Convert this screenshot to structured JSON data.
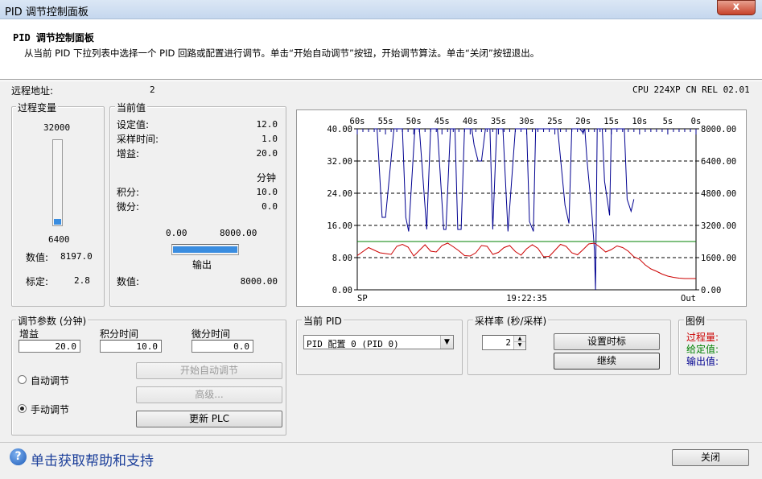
{
  "window": {
    "title": "PID 调节控制面板",
    "close_glyph": "x"
  },
  "header": {
    "title": "PID 调节控制面板",
    "instructions": "从当前 PID 下拉列表中选择一个 PID 回路或配置进行调节。单击“开始自动调节”按钮，开始调节算法。单击“关闭”按钮退出。"
  },
  "remote": {
    "label": "远程地址:",
    "value": "2",
    "cpu": "CPU 224XP CN REL 02.01"
  },
  "process_var": {
    "group_label": "过程变量",
    "max_label": "32000",
    "min_label": "6400",
    "bar_level_fraction": 0.067,
    "value_label": "数值:",
    "value": "8197.0",
    "scaled_label": "标定:",
    "scaled": "2.8"
  },
  "current": {
    "group_label": "当前值",
    "setpoint_label": "设定值:",
    "setpoint": "12.0",
    "sample_label": "采样时间:",
    "sample": "1.0",
    "gain_label": "增益:",
    "gain": "20.0",
    "minutes_label": "分钟",
    "integral_label": "积分:",
    "integral": "10.0",
    "derivative_label": "微分:",
    "derivative": "0.0",
    "out_min": "0.00",
    "out_max": "8000.00",
    "output_label": "输出",
    "output_fraction": 1.0,
    "value_label": "数值:",
    "value": "8000.00"
  },
  "chart_data": {
    "type": "line",
    "time_ticks": [
      "60s",
      "55s",
      "50s",
      "45s",
      "40s",
      "35s",
      "30s",
      "25s",
      "20s",
      "15s",
      "10s",
      "5s",
      "0s"
    ],
    "x_time": [
      60,
      58,
      57,
      56,
      55,
      54,
      53,
      52,
      51,
      50,
      49,
      48,
      47,
      46,
      45,
      44,
      43,
      42,
      41,
      40,
      39,
      38,
      37,
      36,
      35,
      34,
      33,
      32,
      31,
      30,
      29,
      28,
      27,
      26,
      25,
      24,
      23,
      22,
      21,
      20,
      19,
      18,
      17,
      16,
      15,
      14,
      13,
      12,
      11,
      10,
      9,
      8,
      7,
      6,
      5,
      4,
      3,
      2,
      1,
      0
    ],
    "left_axis": {
      "ticks": [
        "40.00",
        "32.00",
        "24.00",
        "16.00",
        "8.00",
        "0.00"
      ],
      "ylim": [
        0,
        40
      ]
    },
    "right_axis": {
      "ticks": [
        "8000.00",
        "6400.00",
        "4800.00",
        "3200.00",
        "1600.00",
        "0.00"
      ],
      "ylim": [
        0,
        8000
      ]
    },
    "bottom_labels": {
      "left": "SP",
      "center": "19:22:35",
      "right": "Out"
    },
    "setpoint_value": 12.0,
    "series": [
      {
        "name": "输出值",
        "color": "#000090",
        "axis": "right",
        "x": [
          57,
          56.5,
          55.6,
          55,
          53.5,
          52,
          51.4,
          50.9,
          49.8,
          49,
          47.7,
          47,
          46.4,
          45.8,
          44.7,
          44.3,
          43.5,
          42.7,
          42.2,
          41.6,
          41,
          40.5,
          40,
          39.7,
          39.3,
          38.6,
          38,
          37.3,
          37,
          36.5,
          36,
          35.3,
          34.5,
          34.2,
          33.3,
          32,
          31.7,
          30.5,
          30,
          29.5,
          28.8,
          28.4,
          27.6,
          27,
          26.4,
          25.7,
          25.3,
          24.5,
          23.2,
          22.5,
          22,
          21.5,
          21,
          20.6,
          20,
          19.7,
          19.3,
          18.5,
          18,
          17.8,
          17.5,
          16.6,
          16.2,
          15.3,
          15,
          14.6,
          13.8,
          13,
          12.7,
          12.2,
          11.5,
          11
        ],
        "y": [
          8000,
          8000,
          3600,
          3600,
          8000,
          8000,
          3600,
          2900,
          8000,
          8000,
          3000,
          8000,
          8000,
          8000,
          3000,
          3000,
          8000,
          8000,
          3000,
          3000,
          8000,
          8000,
          8000,
          8000,
          7200,
          6400,
          6400,
          8000,
          8000,
          8000,
          3000,
          8000,
          8000,
          8000,
          2900,
          8000,
          8000,
          8000,
          8000,
          3400,
          2900,
          8000,
          8000,
          8000,
          8000,
          8000,
          8000,
          8000,
          4200,
          3300,
          8000,
          8000,
          8000,
          8000,
          7800,
          8000,
          6400,
          4000,
          2000,
          0,
          8000,
          8000,
          5400,
          3700,
          8000,
          8000,
          8000,
          8000,
          8000,
          4500,
          3900,
          4500
        ]
      },
      {
        "name": "过程量",
        "color": "#cc0000",
        "axis": "left",
        "x": [
          60,
          58,
          56,
          54,
          53,
          52,
          51,
          50,
          49,
          48,
          47,
          46,
          45,
          44,
          43,
          42,
          41,
          40,
          39,
          38,
          37,
          36,
          35,
          34,
          33,
          32,
          31,
          30,
          29,
          28,
          27,
          26,
          25,
          24,
          23,
          22,
          21,
          20,
          19,
          18,
          17,
          16,
          15,
          14,
          13,
          12,
          11,
          10,
          9,
          8,
          7,
          6,
          5,
          4,
          3,
          2,
          1,
          0
        ],
        "y": [
          8.5,
          10.5,
          9.2,
          8.8,
          10.8,
          11.3,
          10.6,
          8.4,
          9.8,
          11.2,
          9.6,
          9.4,
          11.0,
          11.6,
          10.7,
          9.7,
          8.5,
          8.4,
          9.2,
          11.0,
          10.8,
          8.8,
          9.3,
          10.5,
          11.0,
          9.5,
          8.6,
          10.2,
          11.2,
          10.3,
          8.2,
          8.3,
          9.8,
          11.3,
          10.8,
          9.2,
          8.7,
          10.0,
          11.4,
          11.6,
          10.6,
          9.4,
          10.0,
          10.9,
          10.5,
          9.6,
          8.2,
          7.6,
          6.2,
          5.2,
          4.6,
          3.9,
          3.4,
          3.1,
          2.9,
          2.8,
          2.8,
          2.8
        ]
      },
      {
        "name": "给定值",
        "color": "#008000",
        "axis": "left",
        "x": [
          60,
          0
        ],
        "y": [
          12,
          12
        ]
      }
    ]
  },
  "tuning": {
    "group_label": "调节参数 (分钟)",
    "gain_label": "增益",
    "gain": "20.0",
    "integral_label": "积分时间",
    "integral": "10.0",
    "derivative_label": "微分时间",
    "derivative": "0.0",
    "auto_label": "自动调节",
    "manual_label": "手动调节",
    "start_auto_btn": "开始自动调节",
    "advanced_btn": "高级...",
    "update_plc_btn": "更新 PLC"
  },
  "pid_select": {
    "group_label": "当前 PID",
    "value": "PID 配置 0 (PID 0)"
  },
  "sample_rate": {
    "group_label": "采样率 (秒/采样)",
    "value": "2",
    "set_time_btn": "设置时标",
    "continue_btn": "继续"
  },
  "legend": {
    "group_label": "图例",
    "pv": "过程量:",
    "pv_color": "#cc0000",
    "sp": "给定值:",
    "sp_color": "#008000",
    "out": "输出值:",
    "out_color": "#000090"
  },
  "footer": {
    "help_text": "单击获取帮助和支持",
    "help_icon_glyph": "?",
    "close_btn": "关闭"
  }
}
